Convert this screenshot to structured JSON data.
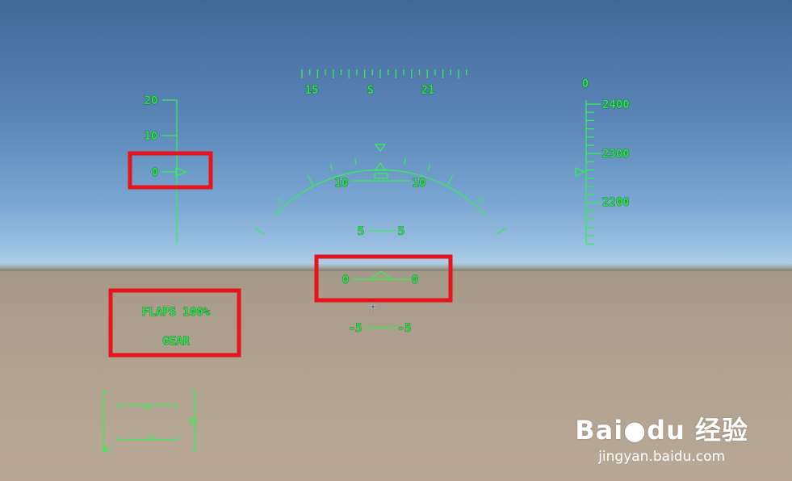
{
  "heading_tape": {
    "labels": [
      "15",
      "S",
      "21"
    ]
  },
  "pitch_scale": {
    "labels": [
      "20",
      "10",
      "0"
    ],
    "pointer_value": 0
  },
  "altitude_tape": {
    "top_label": "0",
    "labels": [
      "2400",
      "2300",
      "2200"
    ]
  },
  "pitch_ladder": {
    "arc_labels": {
      "left": "10",
      "right": "10"
    },
    "rungs": [
      {
        "left": "5",
        "right": "5"
      },
      {
        "left": "0",
        "right": "0"
      },
      {
        "left": "-5",
        "right": "-5"
      }
    ]
  },
  "status": {
    "flaps": "FLAPS 100%",
    "gear": "GEAR"
  },
  "highlight_color": "#e8141c",
  "hud_color": "#28e64a",
  "watermark": {
    "logo": "Bai●du 经验",
    "url": "jingyan.baidu.com"
  }
}
